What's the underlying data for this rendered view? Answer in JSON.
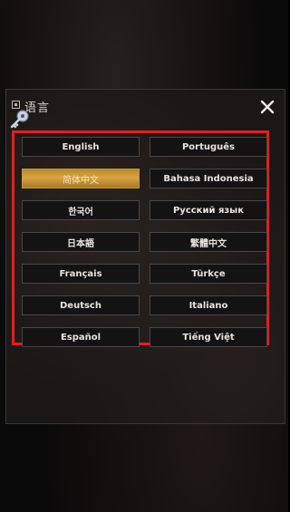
{
  "dialog": {
    "title": "语言",
    "close_icon": "close-icon"
  },
  "languages": [
    {
      "label": "English",
      "selected": false
    },
    {
      "label": "Português",
      "selected": false
    },
    {
      "label": "简体中文",
      "selected": true
    },
    {
      "label": "Bahasa Indonesia",
      "selected": false
    },
    {
      "label": "한국어",
      "selected": false
    },
    {
      "label": "Русский язык",
      "selected": false
    },
    {
      "label": "日本語",
      "selected": false
    },
    {
      "label": "繁體中文",
      "selected": false
    },
    {
      "label": "Français",
      "selected": false
    },
    {
      "label": "Türkçe",
      "selected": false
    },
    {
      "label": "Deutsch",
      "selected": false
    },
    {
      "label": "Italiano",
      "selected": false
    },
    {
      "label": "Español",
      "selected": false
    },
    {
      "label": "Tiếng Việt",
      "selected": false
    }
  ],
  "colors": {
    "highlight_border": "#e02020",
    "selected_button": "#d9a443",
    "button_border": "#4a4644"
  }
}
